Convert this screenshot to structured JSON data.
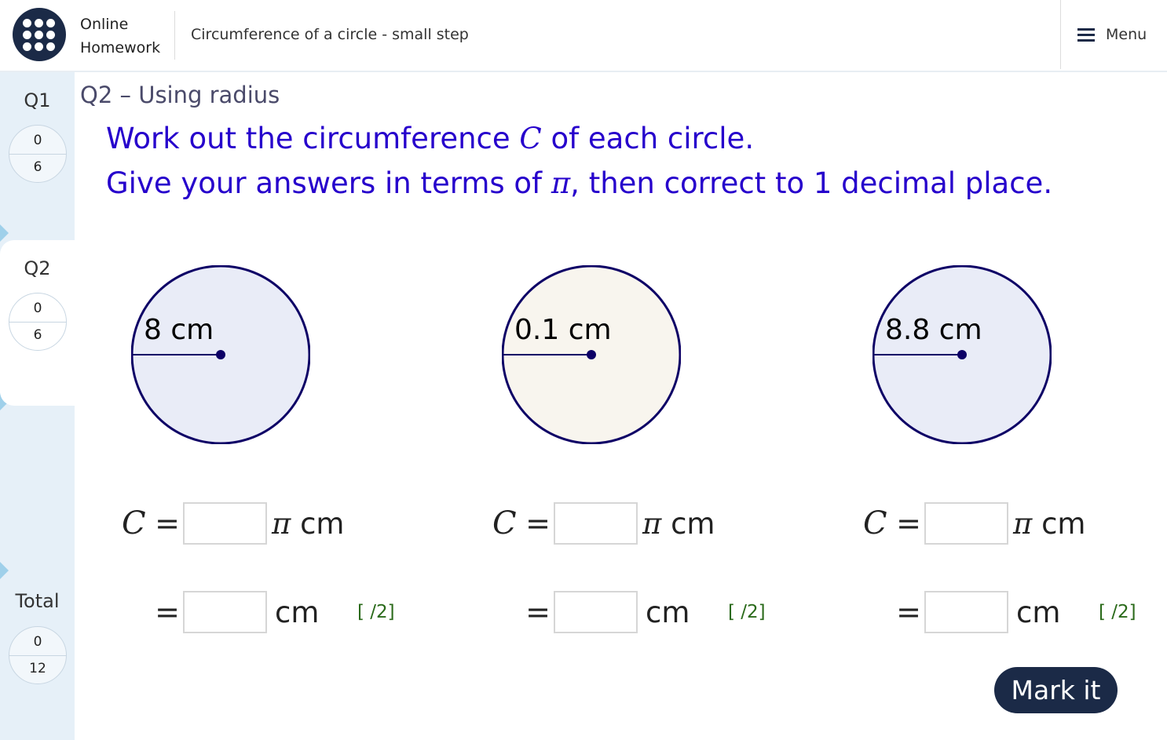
{
  "header": {
    "brand_line1": "Online",
    "brand_line2": "Homework",
    "title": "Circumference of a circle - small step",
    "menu_label": "Menu"
  },
  "sidebar": {
    "questions": [
      {
        "label": "Q1",
        "score": "0",
        "max": "6"
      },
      {
        "label": "Q2",
        "score": "0",
        "max": "6"
      }
    ],
    "total": {
      "label": "Total",
      "score": "0",
      "max": "12"
    }
  },
  "question": {
    "heading": "Q2 – Using radius",
    "instruction1_pre": "Work out the circumference ",
    "instruction1_var": "C",
    "instruction1_post": " of each circle.",
    "instruction2_pre": "Give your answers in terms of ",
    "instruction2_pi": "π",
    "instruction2_post": ", then correct to 1 decimal place."
  },
  "circles": [
    {
      "radius_label": "8 cm",
      "fill": "#e9ecf7"
    },
    {
      "radius_label": "0.1 cm",
      "fill": "#f8f5ee"
    },
    {
      "radius_label": "8.8 cm",
      "fill": "#e9ecf7"
    }
  ],
  "answer_rows": {
    "c_var": "C",
    "equals": "=",
    "pi_symbol": "π",
    "pi_unit": "cm",
    "decimal_unit": "cm",
    "marks_label": "[ /2]",
    "inputs": [
      {
        "pi_value": "",
        "decimal_value": ""
      },
      {
        "pi_value": "",
        "decimal_value": ""
      },
      {
        "pi_value": "",
        "decimal_value": ""
      }
    ]
  },
  "colors": {
    "navy": "#1b2a47",
    "instruction": "#2600cc",
    "circle_stroke": "#0d0066",
    "marks": "#2a6a1a",
    "sidebar_bg": "#e6f0f8"
  },
  "mark_button": "Mark it"
}
